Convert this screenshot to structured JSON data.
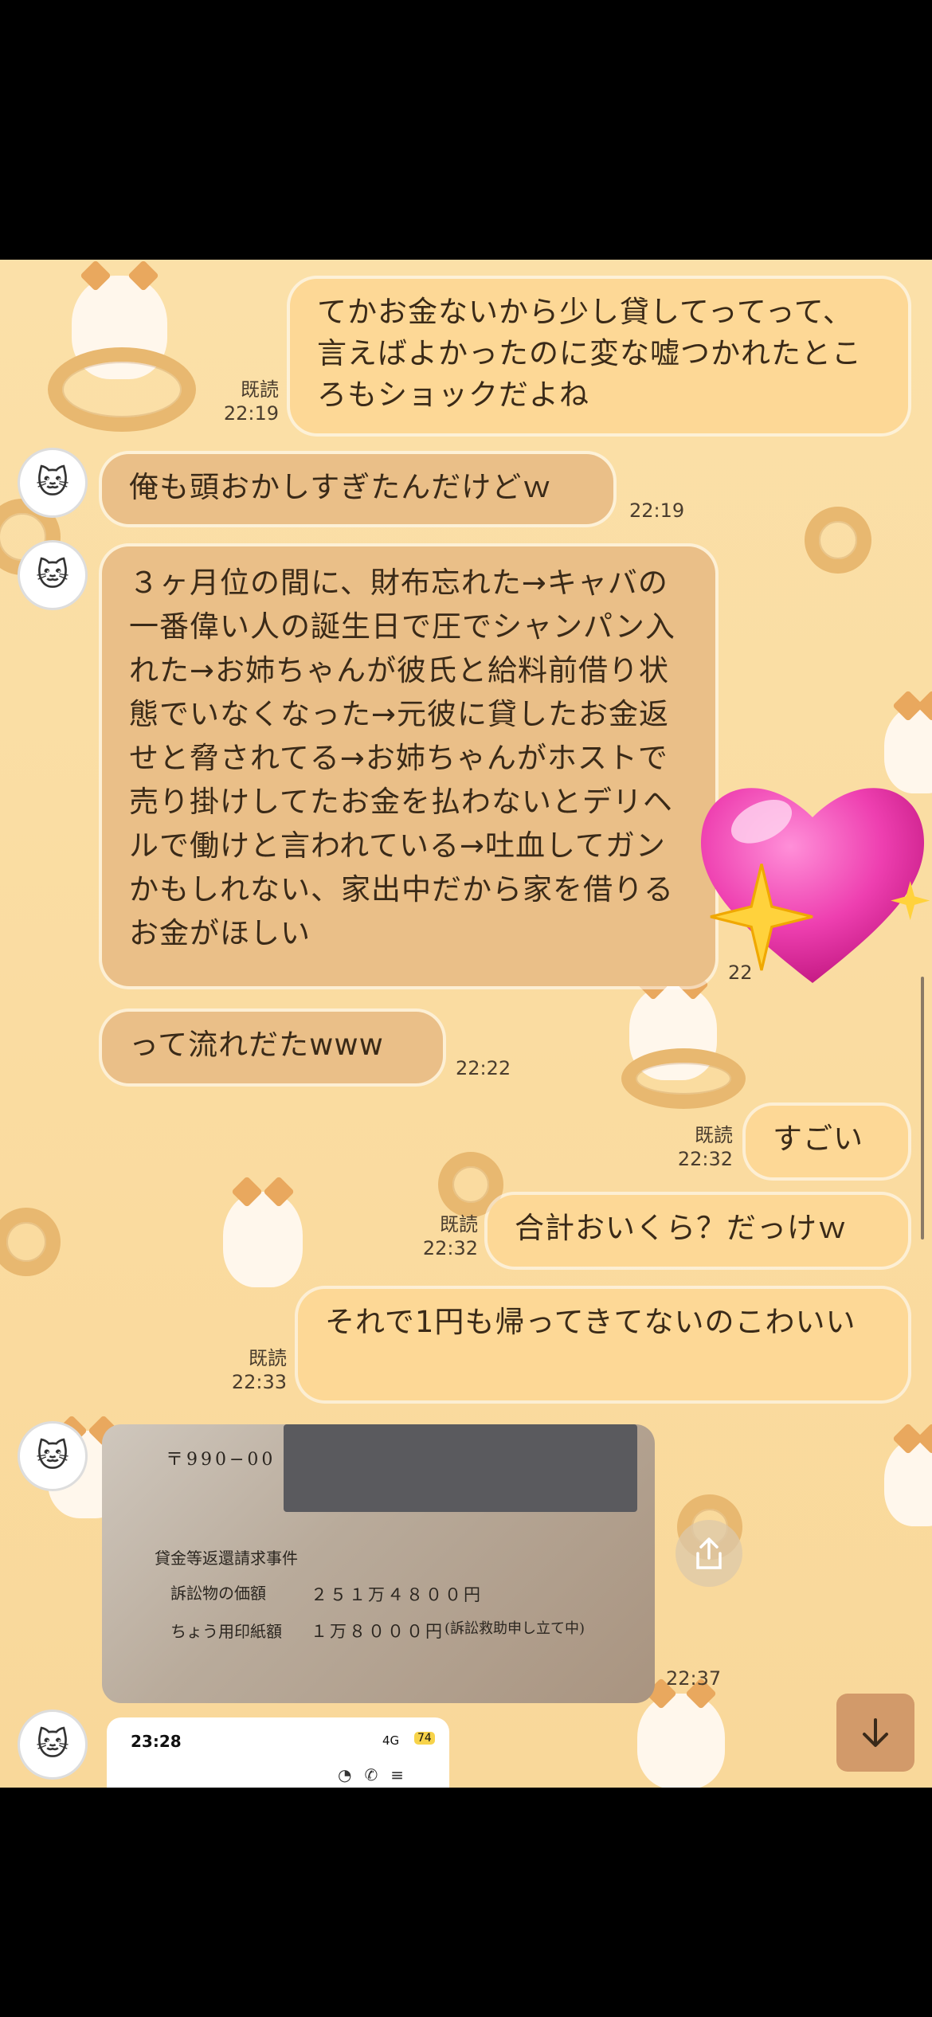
{
  "messages": [
    {
      "text": "てかお金ないから少し貸してってって、言えばよかったのに変な嘘つかれたところもショックだよね",
      "read": "既読",
      "time": "22:19"
    },
    {
      "text": "俺も頭おかしすぎたんだけどｗ",
      "time": "22:19"
    },
    {
      "text": "３ヶ月位の間に、財布忘れた→キャバの一番偉い人の誕生日で圧でシャンパン入れた→お姉ちゃんが彼氏と給料前借り状態でいなくなった→元彼に貸したお金返せと脅されてる→お姉ちゃんがホストで売り掛けしてたお金を払わないとデリヘルで働けと言われている→吐血してガンかもしれない、家出中だから家を借りるお金がほしい",
      "time": "22"
    },
    {
      "text": "って流れだたwww",
      "time": "22:22"
    },
    {
      "text": "すごい",
      "read": "既読",
      "time": "22:32"
    },
    {
      "text": "合計おいくら？だっけｗ",
      "read": "既読",
      "time": "22:32"
    },
    {
      "text": "それで1円も帰ってきてないのこわいい",
      "read": "既読",
      "time": "22:33"
    }
  ],
  "photo": {
    "postal": "〒990−00",
    "case": "貸金等返還請求事件",
    "amount_label": "訴訟物の価額",
    "amount": "２５１万４８００円",
    "stamp_label": "ちょう用印紙額",
    "stamp": "１万８０００円",
    "stamp_note": "(訴訟救助申し立て中)",
    "time": "22:37"
  },
  "thumbnail": {
    "time": "23:28",
    "signal": "4G",
    "battery": "74"
  },
  "icons": {
    "share": "share-icon",
    "scroll_down": "arrow-down-icon",
    "avatar": "cat-sticker-avatar"
  }
}
